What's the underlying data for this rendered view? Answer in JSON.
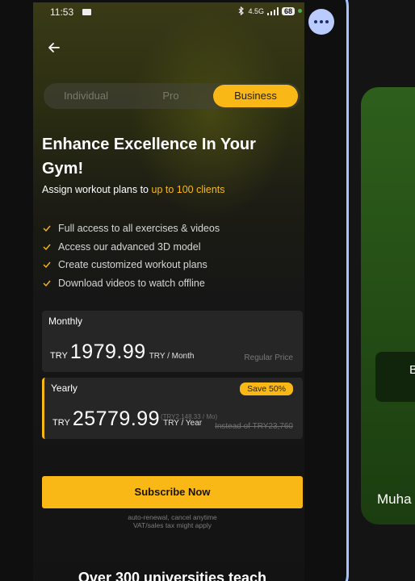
{
  "status_bar": {
    "time": "11:53",
    "network_label": "4.5G",
    "battery": "68"
  },
  "icons": {
    "back": "arrow-left-icon",
    "more": "more-dots-icon",
    "camera": "camera-icon",
    "check": "check-icon"
  },
  "tabs": [
    {
      "label": "Individual",
      "active": false
    },
    {
      "label": "Pro",
      "active": false
    },
    {
      "label": "Business",
      "active": true
    }
  ],
  "headline": "Enhance Excellence In Your Gym!",
  "subline": {
    "prefix": "Assign workout plans to ",
    "highlight": "up to 100 clients"
  },
  "features": [
    "Full access to all exercises & videos",
    "Access our advanced 3D model",
    "Create customized workout plans",
    "Download videos to watch offline"
  ],
  "plans": {
    "monthly": {
      "name": "Monthly",
      "currency": "TRY",
      "amount": "1979.99",
      "period": "TRY / Month",
      "note": "Regular Price"
    },
    "yearly": {
      "name": "Yearly",
      "currency": "TRY",
      "amount": "25779.99",
      "period": "TRY / Year",
      "per_month": "(TRY2,148.33 / Mo)",
      "badge": "Save 50%",
      "instead": "Instead of TRY23,760"
    }
  },
  "subscribe_label": "Subscribe Now",
  "fine_print": {
    "line1": "auto-renewal, cancel anytime",
    "line2": "VAT/sales tax might apply"
  },
  "bottom_heading": "Over 300 universities teach",
  "side_card": {
    "button_text": "B",
    "name_text": "Muha"
  },
  "colors": {
    "accent": "#f9b815",
    "frame": "#a8c4ff",
    "side_card": "#2e5f1c"
  }
}
